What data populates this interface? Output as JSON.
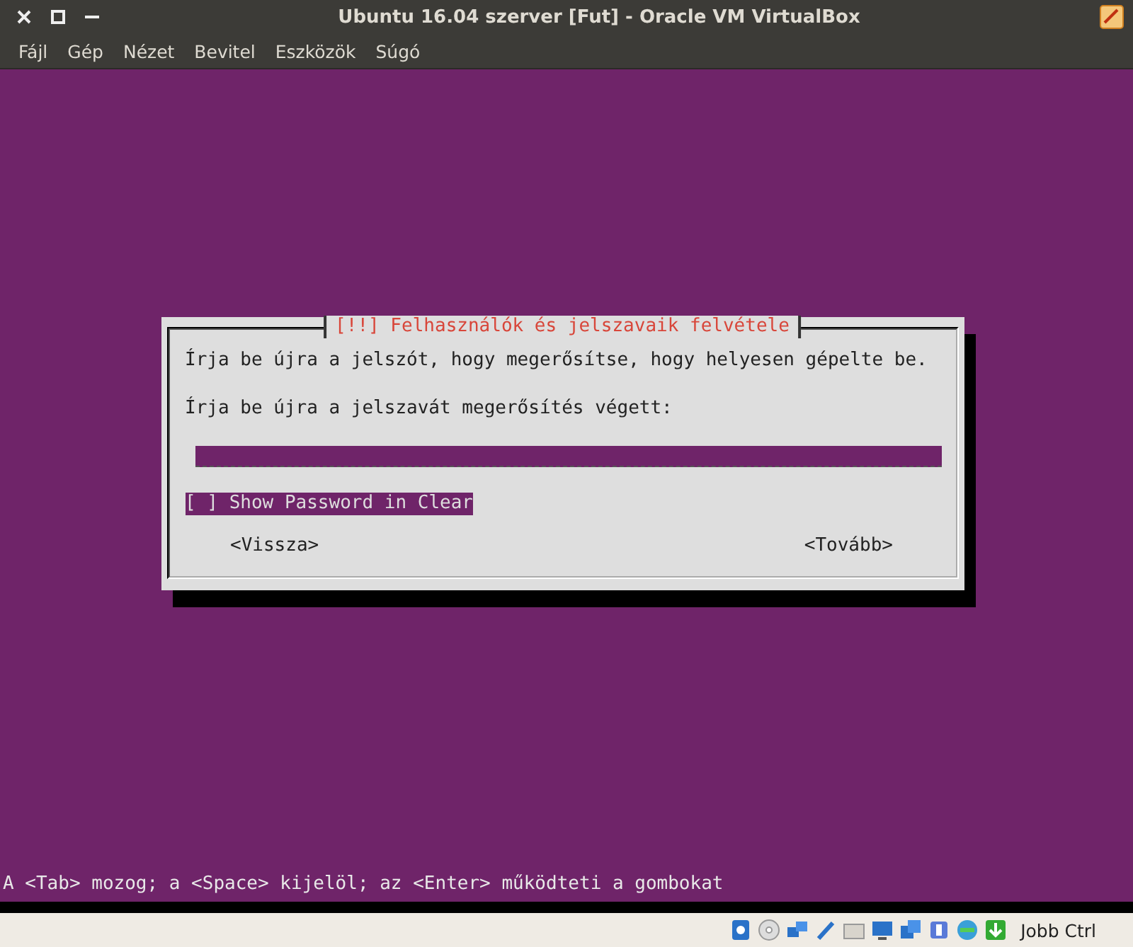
{
  "window": {
    "title": "Ubuntu 16.04 szerver [Fut] - Oracle VM VirtualBox"
  },
  "menu": [
    "Fájl",
    "Gép",
    "Nézet",
    "Bevitel",
    "Eszközök",
    "Súgó"
  ],
  "dialog": {
    "title": "[!!] Felhasználók és jelszavaik felvétele",
    "message": "Írja be újra a jelszót, hogy megerősítse, hogy helyesen gépelte be.",
    "prompt": "Írja be újra a jelszavát megerősítés végett:",
    "password": {
      "focused": false
    },
    "checkbox": {
      "box": "[ ]",
      "label": "Show Password in Clear",
      "checked": false,
      "focused": true
    },
    "buttons": [
      "<Vissza>",
      "<Tovább>"
    ]
  },
  "hint": "A <Tab> mozog; a <Space> kijelöl; az <Enter> működteti a gombokat",
  "status_bar": {
    "key": "Jobb Ctrl"
  }
}
